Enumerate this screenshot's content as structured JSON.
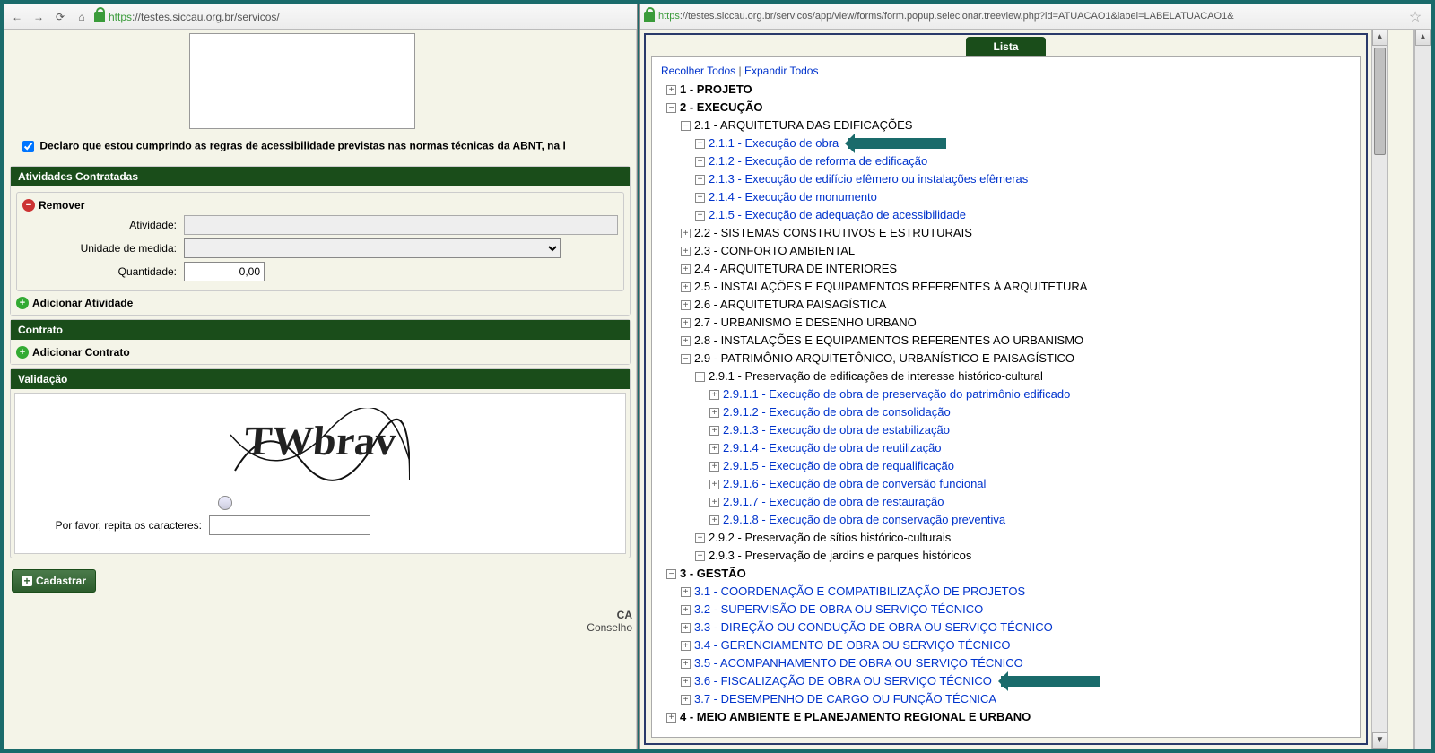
{
  "left": {
    "url_proto": "https",
    "url_rest": "://testes.siccau.org.br/servicos/",
    "declaration": "Declaro que estou cumprindo as regras de acessibilidade previstas nas normas técnicas da ABNT, na l",
    "sec_atividades": "Atividades Contratadas",
    "remove_label": "Remover",
    "field_atividade": "Atividade:",
    "field_unidade": "Unidade de medida:",
    "field_quantidade": "Quantidade:",
    "qty_value": "0,00",
    "add_atividade": "Adicionar Atividade",
    "sec_contrato": "Contrato",
    "add_contrato": "Adicionar Contrato",
    "sec_validacao": "Validação",
    "captcha_label": "Por favor, repita os caracteres:",
    "captcha_text": "TWbrav",
    "btn_cadastrar": "Cadastrar",
    "footer1": "CA",
    "footer2": "Conselho"
  },
  "right": {
    "url_proto": "https",
    "url_rest": "://testes.siccau.org.br/servicos/app/view/forms/form.popup.selecionar.treeview.php?id=ATUACAO1&label=LABELATUACAO1&",
    "tab": "Lista",
    "collapse": "Recolher Todos",
    "expand": "Expandir Todos",
    "tree": {
      "n1": "1 - PROJETO",
      "n2": "2 - EXECUÇÃO",
      "n21": "2.1 - ARQUITETURA DAS EDIFICAÇÕES",
      "n211": "2.1.1 - Execução de obra",
      "n212": "2.1.2 - Execução de reforma de edificação",
      "n213": "2.1.3 - Execução de edifício efêmero ou instalações efêmeras",
      "n214": "2.1.4 - Execução de monumento",
      "n215": "2.1.5 - Execução de adequação de acessibilidade",
      "n22": "2.2 - SISTEMAS CONSTRUTIVOS E ESTRUTURAIS",
      "n23": "2.3 - CONFORTO AMBIENTAL",
      "n24": "2.4 - ARQUITETURA DE INTERIORES",
      "n25": "2.5 - INSTALAÇÕES E EQUIPAMENTOS REFERENTES À ARQUITETURA",
      "n26": "2.6 - ARQUITETURA PAISAGÍSTICA",
      "n27": "2.7 - URBANISMO E DESENHO URBANO",
      "n28": "2.8 - INSTALAÇÕES E EQUIPAMENTOS REFERENTES AO URBANISMO",
      "n29": "2.9 - PATRIMÔNIO ARQUITETÔNICO, URBANÍSTICO E PAISAGÍSTICO",
      "n291": "2.9.1 - Preservação de edificações de interesse histórico-cultural",
      "n2911": "2.9.1.1 - Execução de obra de preservação do patrimônio edificado",
      "n2912": "2.9.1.2 - Execução de obra de consolidação",
      "n2913": "2.9.1.3 - Execução de obra de estabilização",
      "n2914": "2.9.1.4 - Execução de obra de reutilização",
      "n2915": "2.9.1.5 - Execução de obra de requalificação",
      "n2916": "2.9.1.6 - Execução de obra de conversão funcional",
      "n2917": "2.9.1.7 - Execução de obra de restauração",
      "n2918": "2.9.1.8 - Execução de obra de conservação preventiva",
      "n292": "2.9.2 - Preservação de sítios histórico-culturais",
      "n293": "2.9.3 - Preservação de jardins e parques históricos",
      "n3": "3 - GESTÃO",
      "n31": "3.1 - COORDENAÇÃO E COMPATIBILIZAÇÃO DE PROJETOS",
      "n32": "3.2 - SUPERVISÃO DE OBRA OU SERVIÇO TÉCNICO",
      "n33": "3.3 - DIREÇÃO OU CONDUÇÃO DE OBRA OU SERVIÇO TÉCNICO",
      "n34": "3.4 - GERENCIAMENTO DE OBRA OU SERVIÇO TÉCNICO",
      "n35": "3.5 - ACOMPANHAMENTO DE OBRA OU SERVIÇO TÉCNICO",
      "n36": "3.6 - FISCALIZAÇÃO DE OBRA OU SERVIÇO TÉCNICO",
      "n37": "3.7 - DESEMPENHO DE CARGO OU FUNÇÃO TÉCNICA",
      "n4": "4 - MEIO AMBIENTE E PLANEJAMENTO REGIONAL E URBANO"
    }
  }
}
